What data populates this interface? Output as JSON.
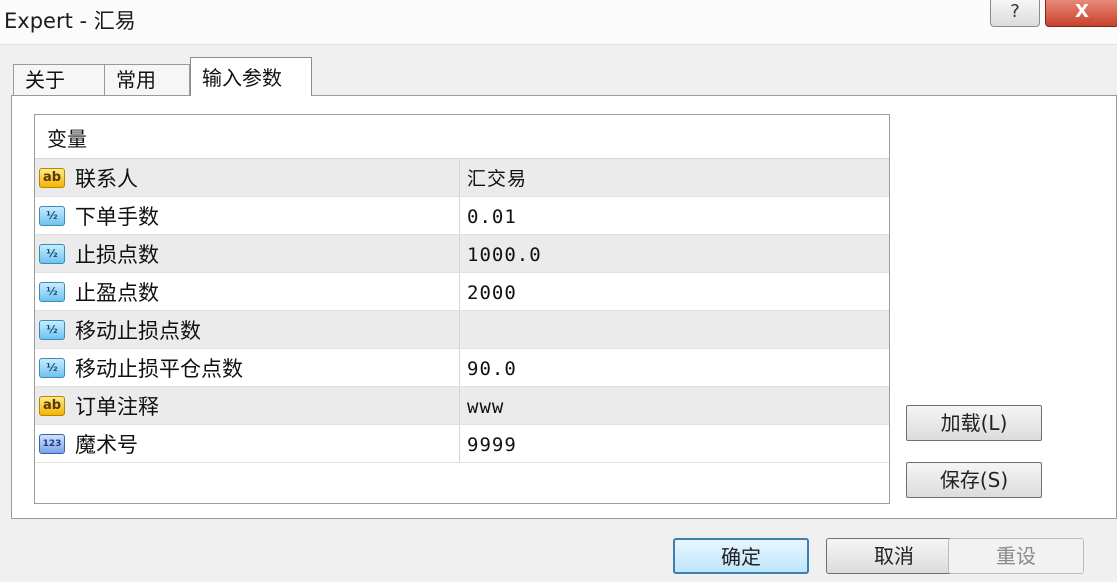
{
  "window": {
    "title": "Expert - 汇易",
    "help_label": "?",
    "close_label": "X"
  },
  "tabs": [
    {
      "label": "关于",
      "active": false
    },
    {
      "label": "常用",
      "active": false
    },
    {
      "label": "输入参数",
      "active": true
    }
  ],
  "grid": {
    "header": "变量",
    "rows": [
      {
        "icon": "string-type-icon",
        "icon_text": "ab",
        "name": "联系人",
        "value": "汇交易"
      },
      {
        "icon": "double-type-icon",
        "icon_text": "½",
        "name": "下单手数",
        "value": "0.01"
      },
      {
        "icon": "double-type-icon",
        "icon_text": "½",
        "name": "止损点数",
        "value": "1000.0"
      },
      {
        "icon": "double-type-icon",
        "icon_text": "½",
        "name": "止盈点数",
        "value": "2000"
      },
      {
        "icon": "double-type-icon",
        "icon_text": "½",
        "name": "移动止损点数",
        "value": ""
      },
      {
        "icon": "double-type-icon",
        "icon_text": "½",
        "name": "移动止损平仓点数",
        "value": "90.0"
      },
      {
        "icon": "string-type-icon",
        "icon_text": "ab",
        "name": "订单注释",
        "value": "www"
      },
      {
        "icon": "integer-type-icon",
        "icon_text": "123",
        "name": "魔术号",
        "value": "9999"
      }
    ]
  },
  "side_buttons": {
    "load_label": "加载(L)",
    "save_label": "保存(S)"
  },
  "bottom_buttons": {
    "ok_label": "确定",
    "cancel_label": "取消",
    "reset_label": "重设"
  }
}
